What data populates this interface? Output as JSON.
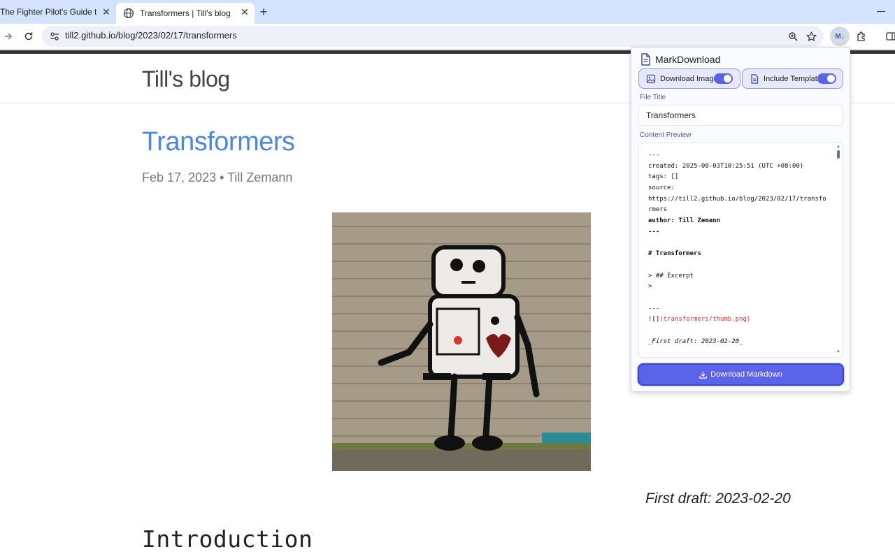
{
  "browser": {
    "tabs": [
      {
        "title": "The Fighter Pilot's Guide to S"
      },
      {
        "title": "Transformers | Till's blog"
      }
    ],
    "url": "till2.github.io/blog/2023/02/17/transformers",
    "extension_badge": "M↓"
  },
  "page": {
    "site_title": "Till's blog",
    "post_title": "Transformers",
    "post_meta": "Feb 17, 2023 • Till Zemann",
    "first_draft": "First draft: 2023-02-20",
    "intro_heading": "Introduction"
  },
  "popup": {
    "title": "MarkDownload",
    "toggles": [
      {
        "label": "Download Images",
        "on": true
      },
      {
        "label": "Include Template",
        "on": true
      }
    ],
    "file_title_label": "File Title",
    "file_title_value": "Transformers",
    "content_preview_label": "Content Preview",
    "preview_lines": [
      {
        "text": "---"
      },
      {
        "text": "created: 2025-08-03T10:25:51 (UTC +08:00)"
      },
      {
        "text": "tags: []"
      },
      {
        "text": "source:"
      },
      {
        "text": "https://till2.github.io/blog/2023/02/17/transfo"
      },
      {
        "text": "rmers"
      },
      {
        "text": "author: Till Zemann",
        "bold": true
      },
      {
        "text": "---",
        "bold": true
      },
      {
        "text": ""
      },
      {
        "text": "# Transformers",
        "bold": true
      },
      {
        "text": ""
      },
      {
        "text": "> ## Excerpt"
      },
      {
        "text": ">"
      },
      {
        "text": ""
      },
      {
        "text": "---"
      },
      {
        "text": "![]",
        "red": "(transformers/thumb.png)"
      },
      {
        "text": ""
      },
      {
        "text": "_First draft: 2023-02-20_",
        "italic": true
      }
    ],
    "download_button": "Download Markdown"
  },
  "colors": {
    "accent": "#5b63e8",
    "post_title": "#4a89dc",
    "tabbar": "#d3e3fd"
  }
}
